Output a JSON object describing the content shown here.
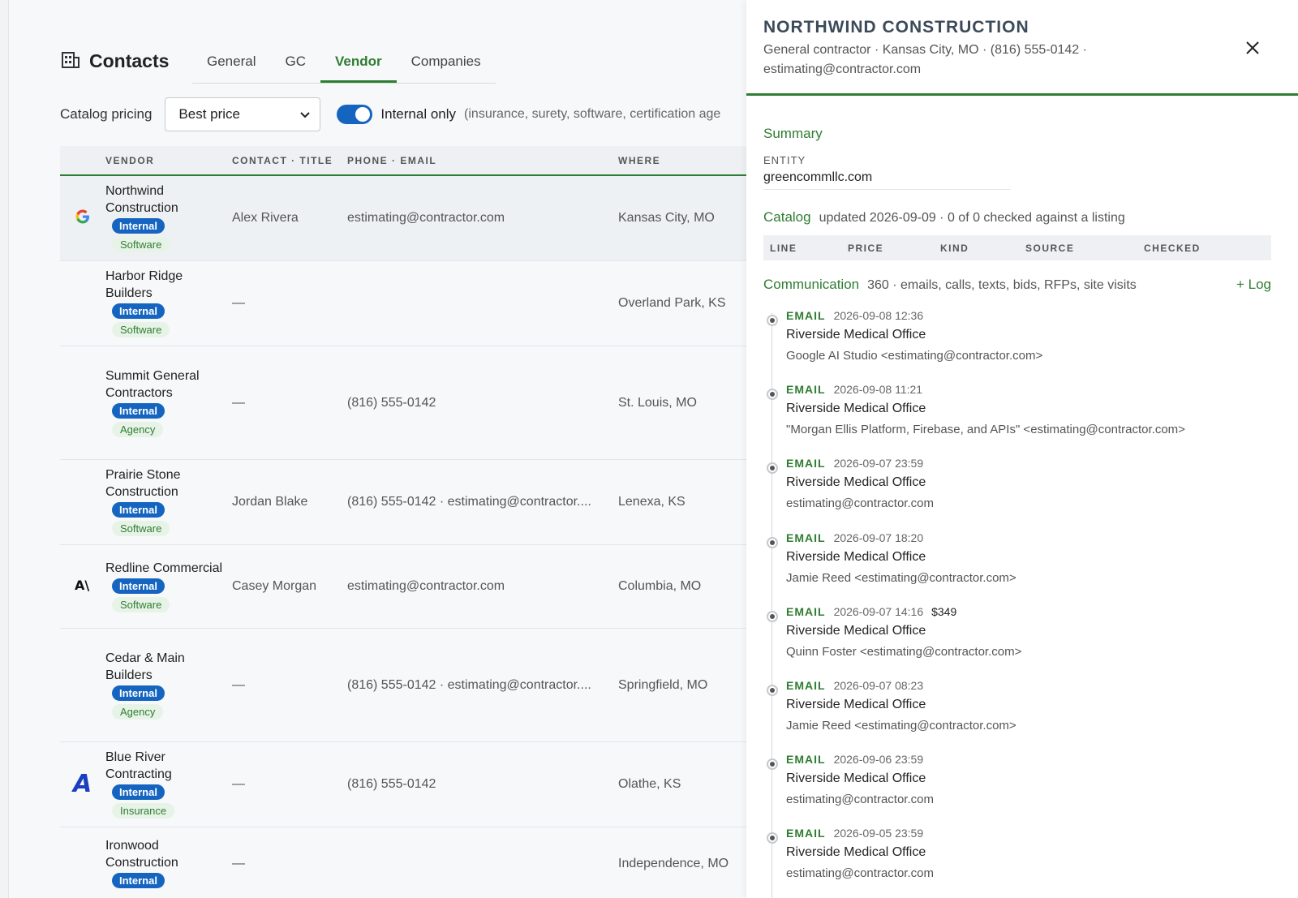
{
  "page": {
    "title": "Contacts"
  },
  "tabs": [
    {
      "label": "General",
      "active": false
    },
    {
      "label": "GC",
      "active": false
    },
    {
      "label": "Vendor",
      "active": true
    },
    {
      "label": "Companies",
      "active": false
    }
  ],
  "pricing": {
    "label": "Catalog pricing",
    "selected": "Best price",
    "internal_label": "Internal only",
    "internal_hint": "(insurance, surety, software, certification age",
    "internal_on": true
  },
  "table": {
    "headers": [
      "VENDOR",
      "CONTACT · TITLE",
      "PHONE · EMAIL",
      "WHERE"
    ],
    "rows": [
      {
        "logo": "google-icon",
        "name": "Northwind Construction",
        "badge": "Internal",
        "kind": "Software",
        "contact": "Alex Rivera",
        "phone_email": "estimating@contractor.com",
        "where": "Kansas City, MO",
        "selected": true
      },
      {
        "logo": "",
        "name": "Harbor Ridge Builders",
        "badge": "Internal",
        "kind": "Software",
        "contact": "—",
        "phone_email": "",
        "where": "Overland Park, KS",
        "selected": false
      },
      {
        "logo": "",
        "name": "Summit General Contractors",
        "badge": "Internal",
        "kind": "Agency",
        "contact": "—",
        "phone_email": "(816) 555-0142",
        "where": "St. Louis, MO",
        "selected": false
      },
      {
        "logo": "",
        "name": "Prairie Stone Construction",
        "badge": "Internal",
        "kind": "Software",
        "contact": "Jordan Blake",
        "phone_email": "(816) 555-0142 · estimating@contractor....",
        "where": "Lenexa, KS",
        "selected": false
      },
      {
        "logo": "anthropic-icon",
        "name": "Redline Commercial",
        "badge": "Internal",
        "kind": "Software",
        "contact": "Casey Morgan",
        "phone_email": "estimating@contractor.com",
        "where": "Columbia, MO",
        "selected": false
      },
      {
        "logo": "",
        "name": "Cedar & Main Builders",
        "badge": "Internal",
        "kind": "Agency",
        "contact": "—",
        "phone_email": "(816) 555-0142 · estimating@contractor....",
        "where": "Springfield, MO",
        "selected": false
      },
      {
        "logo": "letter-a-icon",
        "name": "Blue River Contracting",
        "badge": "Internal",
        "kind": "Insurance",
        "contact": "—",
        "phone_email": "(816) 555-0142",
        "where": "Olathe, KS",
        "selected": false
      },
      {
        "logo": "",
        "name": "Ironwood Construction",
        "badge": "Internal",
        "kind": "",
        "contact": "—",
        "phone_email": "",
        "where": "Independence, MO",
        "selected": false
      }
    ]
  },
  "panel": {
    "title": "NORTHWIND CONSTRUCTION",
    "subtitle": "General contractor · Kansas City, MO · (816) 555-0142 · estimating@contractor.com",
    "summary_title": "Summary",
    "entity_label": "ENTITY",
    "entity_value": "greencommllc.com",
    "catalog_title": "Catalog",
    "catalog_meta": "updated 2026-09-09 · 0 of 0 checked against a listing",
    "catalog_headers": [
      "LINE",
      "PRICE",
      "KIND",
      "SOURCE",
      "CHECKED"
    ],
    "comm_title": "Communication",
    "comm_meta": "360 · emails, calls, texts, bids, RFPs, site visits",
    "log_label": "+ Log",
    "entries": [
      {
        "type": "EMAIL",
        "time": "2026-09-08 12:36",
        "amount": "",
        "subject": "Riverside Medical Office",
        "from": "Google AI Studio <estimating@contractor.com>"
      },
      {
        "type": "EMAIL",
        "time": "2026-09-08 11:21",
        "amount": "",
        "subject": "Riverside Medical Office",
        "from": "\"Morgan Ellis Platform, Firebase, and APIs\" <estimating@contractor.com>"
      },
      {
        "type": "EMAIL",
        "time": "2026-09-07 23:59",
        "amount": "",
        "subject": "Riverside Medical Office",
        "from": "estimating@contractor.com"
      },
      {
        "type": "EMAIL",
        "time": "2026-09-07 18:20",
        "amount": "",
        "subject": "Riverside Medical Office",
        "from": "Jamie Reed <estimating@contractor.com>"
      },
      {
        "type": "EMAIL",
        "time": "2026-09-07 14:16",
        "amount": "$349",
        "subject": "Riverside Medical Office",
        "from": "Quinn Foster <estimating@contractor.com>"
      },
      {
        "type": "EMAIL",
        "time": "2026-09-07 08:23",
        "amount": "",
        "subject": "Riverside Medical Office",
        "from": "Jamie Reed <estimating@contractor.com>"
      },
      {
        "type": "EMAIL",
        "time": "2026-09-06 23:59",
        "amount": "",
        "subject": "Riverside Medical Office",
        "from": "estimating@contractor.com"
      },
      {
        "type": "EMAIL",
        "time": "2026-09-05 23:59",
        "amount": "",
        "subject": "Riverside Medical Office",
        "from": "estimating@contractor.com"
      }
    ]
  }
}
